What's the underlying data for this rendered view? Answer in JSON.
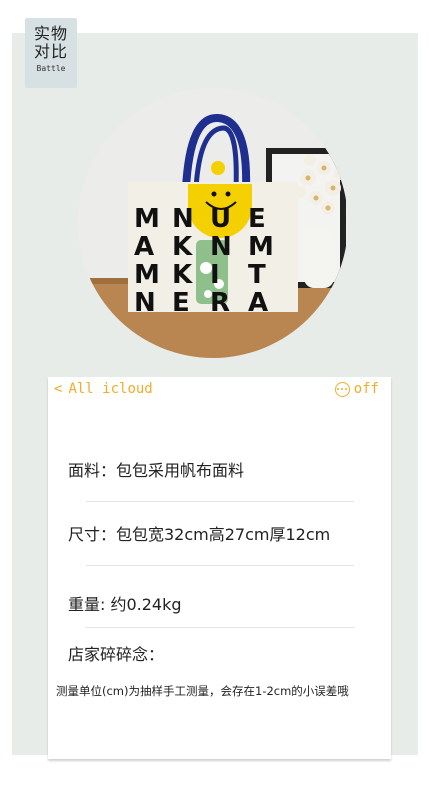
{
  "tag": {
    "line1": "实物",
    "line2": "对比",
    "sub": "Battle"
  },
  "photo": {
    "alt": "tote bag with phone comparison"
  },
  "bag_letters": [
    [
      "M",
      "N",
      "U",
      "E"
    ],
    [
      "A",
      "K",
      "N",
      "M"
    ],
    [
      "M",
      "K",
      "I",
      "T"
    ],
    [
      "N",
      "E",
      "R",
      "A"
    ]
  ],
  "card": {
    "back_label": "All icloud",
    "right_label": "off",
    "material": "面料：包包采用帆布面料",
    "size": "尺寸：包包宽32cm高27cm厚12cm",
    "weight": "重量:  约0.24kg",
    "notes_title": "店家碎碎念：",
    "notes_text": "测量单位(cm)为抽样手工测量，会存在1-2cm的小误差哦"
  },
  "colors": {
    "accent": "#f1ad2a",
    "panel": "#e8ece9",
    "tag": "#d7e0e3"
  },
  "icons": {
    "back": "chevron-left-icon",
    "more": "more-dots-icon"
  }
}
